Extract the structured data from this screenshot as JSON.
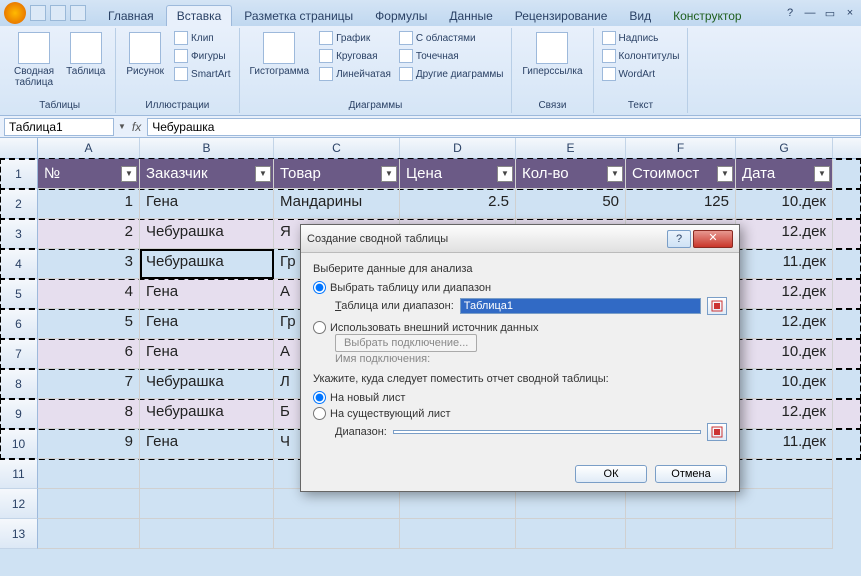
{
  "tabs": {
    "home": "Главная",
    "insert": "Вставка",
    "layout": "Разметка страницы",
    "formulas": "Формулы",
    "data": "Данные",
    "review": "Рецензирование",
    "view": "Вид",
    "design": "Конструктор"
  },
  "ribbon": {
    "tables": {
      "title": "Таблицы",
      "pivot": "Сводная\nтаблица",
      "table": "Таблица"
    },
    "illus": {
      "title": "Иллюстрации",
      "picture": "Рисунок",
      "clip": "Клип",
      "shapes": "Фигуры",
      "smartart": "SmartArt"
    },
    "charts": {
      "title": "Диаграммы",
      "hist": "Гистограмма",
      "line": "График",
      "pie": "Круговая",
      "bar": "Линейчатая",
      "area": "С областями",
      "scatter": "Точечная",
      "other": "Другие диаграммы"
    },
    "links": {
      "title": "Связи",
      "hyperlink": "Гиперссылка"
    },
    "text": {
      "title": "Текст",
      "textbox": "Надпись",
      "headerfooter": "Колонтитулы",
      "wordart": "WordArt"
    }
  },
  "namebox": "Таблица1",
  "formula": "Чебурашка",
  "columns": [
    "A",
    "B",
    "C",
    "D",
    "E",
    "F",
    "G"
  ],
  "headers": {
    "no": "№",
    "cust": "Заказчик",
    "prod": "Товар",
    "price": "Цена",
    "qty": "Кол-во",
    "cost": "Стоимост",
    "date": "Дата"
  },
  "rows": [
    {
      "n": "1",
      "no": "1",
      "cust": "Гена",
      "prod": "Мандарины",
      "price": "2.5",
      "qty": "50",
      "cost": "125",
      "date": "10.дек"
    },
    {
      "n": "2",
      "no": "2",
      "cust": "Чебурашка",
      "prod": "Я",
      "price": "",
      "qty": "",
      "cost": "",
      "date": "12.дек"
    },
    {
      "n": "3",
      "no": "3",
      "cust": "Чебурашка",
      "prod": "Гр",
      "price": "",
      "qty": "",
      "cost": "",
      "date": "11.дек"
    },
    {
      "n": "4",
      "no": "4",
      "cust": "Гена",
      "prod": "А",
      "price": "",
      "qty": "",
      "cost": "",
      "date": "12.дек"
    },
    {
      "n": "5",
      "no": "5",
      "cust": "Гена",
      "prod": "Гр",
      "price": "",
      "qty": "",
      "cost": "",
      "date": "12.дек"
    },
    {
      "n": "6",
      "no": "6",
      "cust": "Гена",
      "prod": "А",
      "price": "",
      "qty": "",
      "cost": "",
      "date": "10.дек"
    },
    {
      "n": "7",
      "no": "7",
      "cust": "Чебурашка",
      "prod": "Л",
      "price": "",
      "qty": "",
      "cost": "",
      "date": "10.дек"
    },
    {
      "n": "8",
      "no": "8",
      "cust": "Чебурашка",
      "prod": "Б",
      "price": "",
      "qty": "",
      "cost": "",
      "date": "12.дек"
    },
    {
      "n": "9",
      "no": "9",
      "cust": "Гена",
      "prod": "Ч",
      "price": "",
      "qty": "",
      "cost": "",
      "date": "11.дек"
    }
  ],
  "empty_rows": [
    "11",
    "12",
    "13"
  ],
  "dialog": {
    "title": "Создание сводной таблицы",
    "select_data": "Выберите данные для анализа",
    "opt_table": "Выбрать таблицу или диапазон",
    "range_label": "Таблица или диапазон:",
    "range_value": "Таблица1",
    "opt_external": "Использовать внешний источник данных",
    "choose_conn": "Выбрать подключение...",
    "conn_name": "Имя подключения:",
    "place_label": "Укажите, куда следует поместить отчет сводной таблицы:",
    "opt_newsheet": "На новый лист",
    "opt_existing": "На существующий лист",
    "range2_label": "Диапазон:",
    "ok": "ОК",
    "cancel": "Отмена"
  }
}
